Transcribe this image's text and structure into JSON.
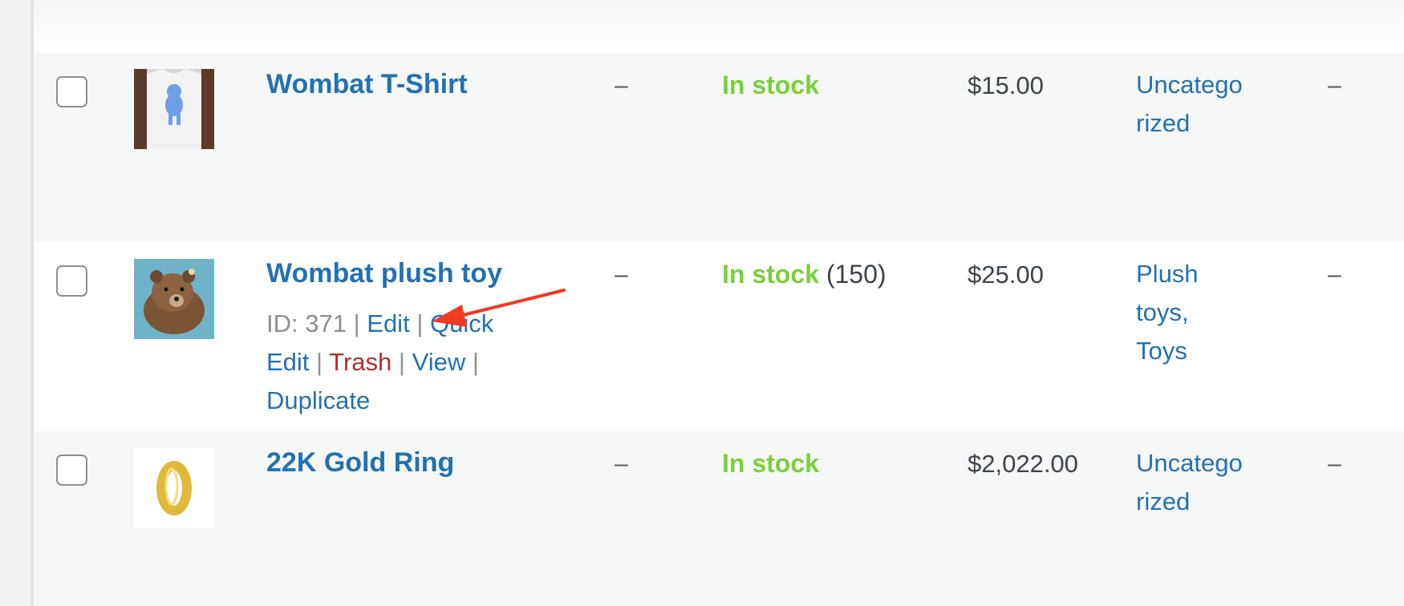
{
  "products": [
    {
      "name": "Wombat T-Shirt",
      "sku": "–",
      "stock_status": "In stock",
      "stock_qty": "",
      "price": "$15.00",
      "categories": [
        "Uncatego",
        "rized"
      ],
      "tags": "–",
      "thumbnail_icon": "t-shirt-thumbnail"
    },
    {
      "name": "Wombat plush toy",
      "sku": "–",
      "stock_status": "In stock",
      "stock_qty": "(150)",
      "price": "$25.00",
      "categories": [
        "Plush",
        "toys,",
        "Toys"
      ],
      "tags": "–",
      "thumbnail_icon": "plush-toy-thumbnail",
      "row_actions": {
        "id_text": "ID: 371",
        "separator": "|",
        "edit": "Edit",
        "quick_edit": "Quick Edit",
        "trash": "Trash",
        "view": "View",
        "duplicate": "Duplicate"
      }
    },
    {
      "name": "22K Gold Ring",
      "sku": "–",
      "stock_status": "In stock",
      "stock_qty": "",
      "price": "$2,022.00",
      "categories": [
        "Uncatego",
        "rized"
      ],
      "tags": "–",
      "thumbnail_icon": "gold-ring-thumbnail"
    }
  ],
  "colors": {
    "link": "#2271b1",
    "in_stock": "#7ad03a",
    "trash": "#b32d2e",
    "annotation_arrow": "#f03a21",
    "alt_row": "#f6f7f7"
  }
}
